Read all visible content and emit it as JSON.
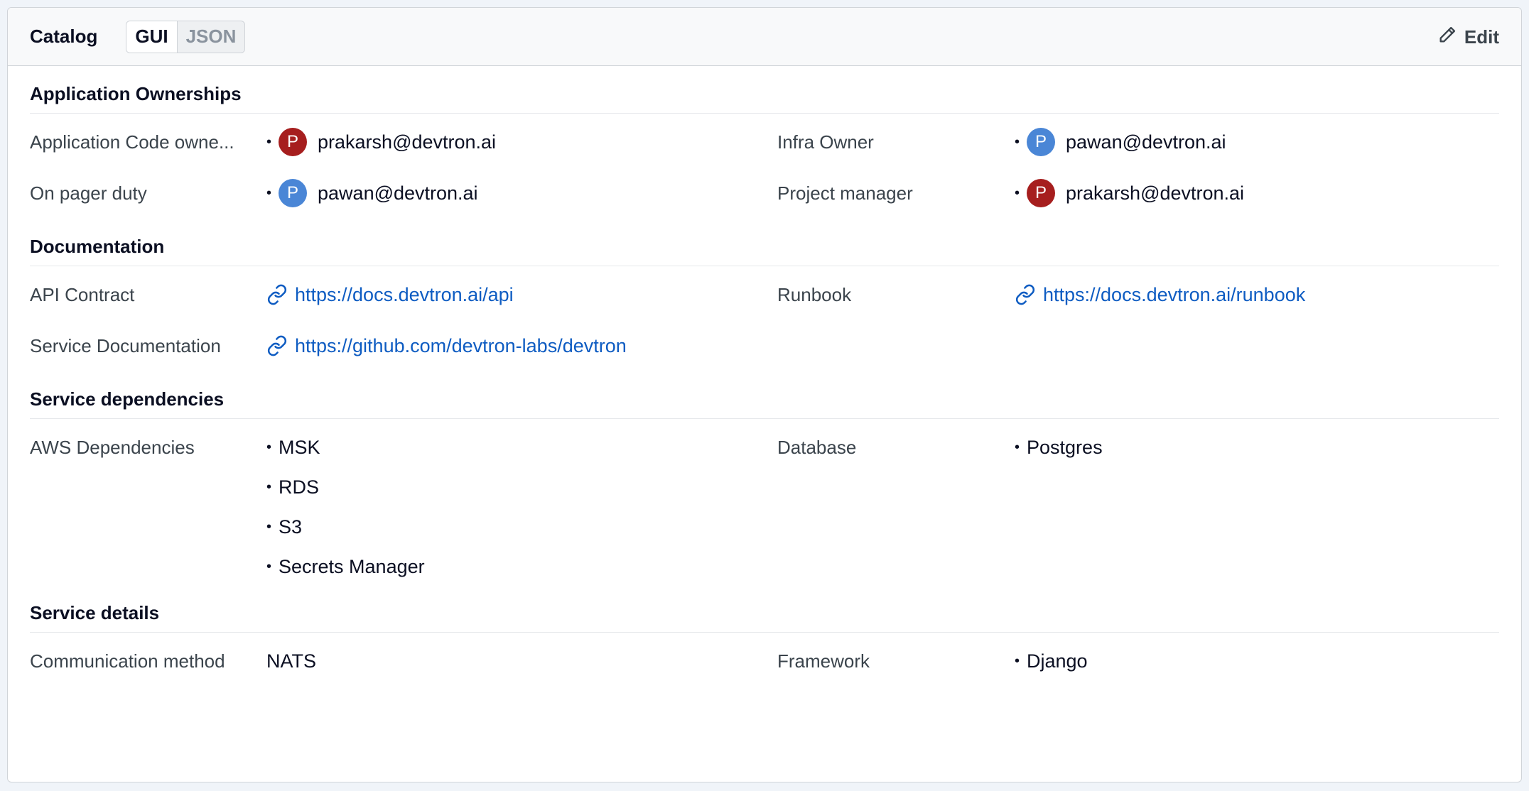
{
  "header": {
    "title": "Catalog",
    "toggle": {
      "gui": "GUI",
      "json": "JSON"
    },
    "edit_label": "Edit"
  },
  "colors": {
    "avatar_p_red": "#a61e1e",
    "avatar_p_blue": "#4a86d6",
    "link": "#0e5cc2"
  },
  "sections": {
    "ownerships": {
      "title": "Application Ownerships",
      "code_owner": {
        "label": "Application Code owne...",
        "user": "prakarsh@devtron.ai",
        "initial": "P"
      },
      "infra_owner": {
        "label": "Infra Owner",
        "user": "pawan@devtron.ai",
        "initial": "P"
      },
      "pager_duty": {
        "label": "On pager duty",
        "user": "pawan@devtron.ai",
        "initial": "P"
      },
      "project_manager": {
        "label": "Project manager",
        "user": "prakarsh@devtron.ai",
        "initial": "P"
      }
    },
    "documentation": {
      "title": "Documentation",
      "api": {
        "label": "API Contract",
        "url": "https://docs.devtron.ai/api"
      },
      "runbook": {
        "label": "Runbook",
        "url": "https://docs.devtron.ai/runbook"
      },
      "service_docs": {
        "label": "Service Documentation",
        "url": "https://github.com/devtron-labs/devtron"
      }
    },
    "dependencies": {
      "title": "Service dependencies",
      "aws": {
        "label": "AWS Dependencies",
        "items": [
          "MSK",
          "RDS",
          "S3",
          "Secrets Manager"
        ]
      },
      "database": {
        "label": "Database",
        "items": [
          "Postgres"
        ]
      }
    },
    "details": {
      "title": "Service details",
      "communication": {
        "label": "Communication method",
        "value": "NATS"
      },
      "framework": {
        "label": "Framework",
        "items": [
          "Django"
        ]
      }
    }
  }
}
